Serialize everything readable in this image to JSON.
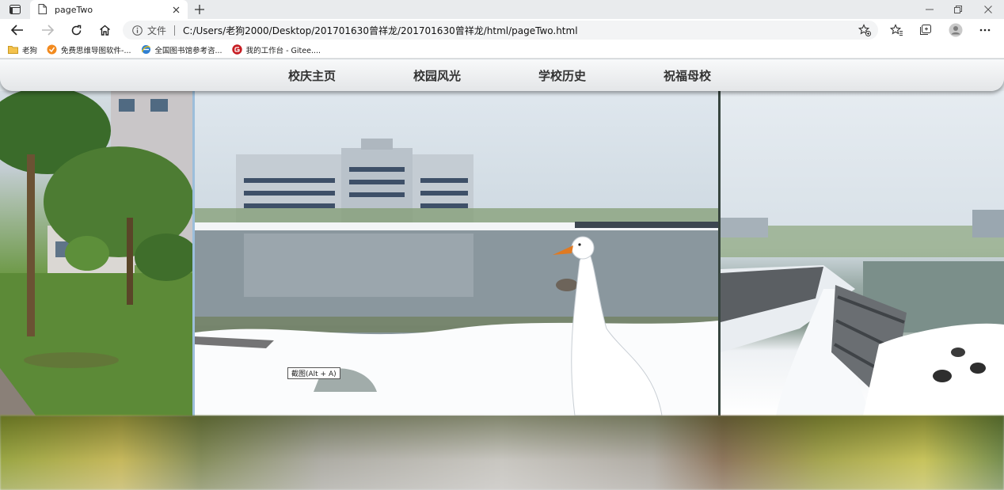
{
  "browser": {
    "tab_title": "pageTwo",
    "address_label": "文件",
    "url": "C:/Users/老狗2000/Desktop/201701630曾祥龙/201701630曾祥龙/html/pageTwo.html",
    "bookmarks": [
      {
        "label": "老狗",
        "icon": "folder-icon"
      },
      {
        "label": "免费思维导图软件-...",
        "icon": "mindmap-site-icon"
      },
      {
        "label": "全国图书馆参考咨...",
        "icon": "ie-globe-icon"
      },
      {
        "label": "我的工作台 - Gitee....",
        "icon": "gitee-icon"
      }
    ]
  },
  "site": {
    "nav": [
      "校庆主页",
      "校园风光",
      "学校历史",
      "祝福母校"
    ],
    "tooltip": "截图(Alt + A)"
  },
  "colors": {
    "navbar_bg": "#eceef0",
    "nav_text": "#333333",
    "gitee_red": "#c71d23"
  }
}
